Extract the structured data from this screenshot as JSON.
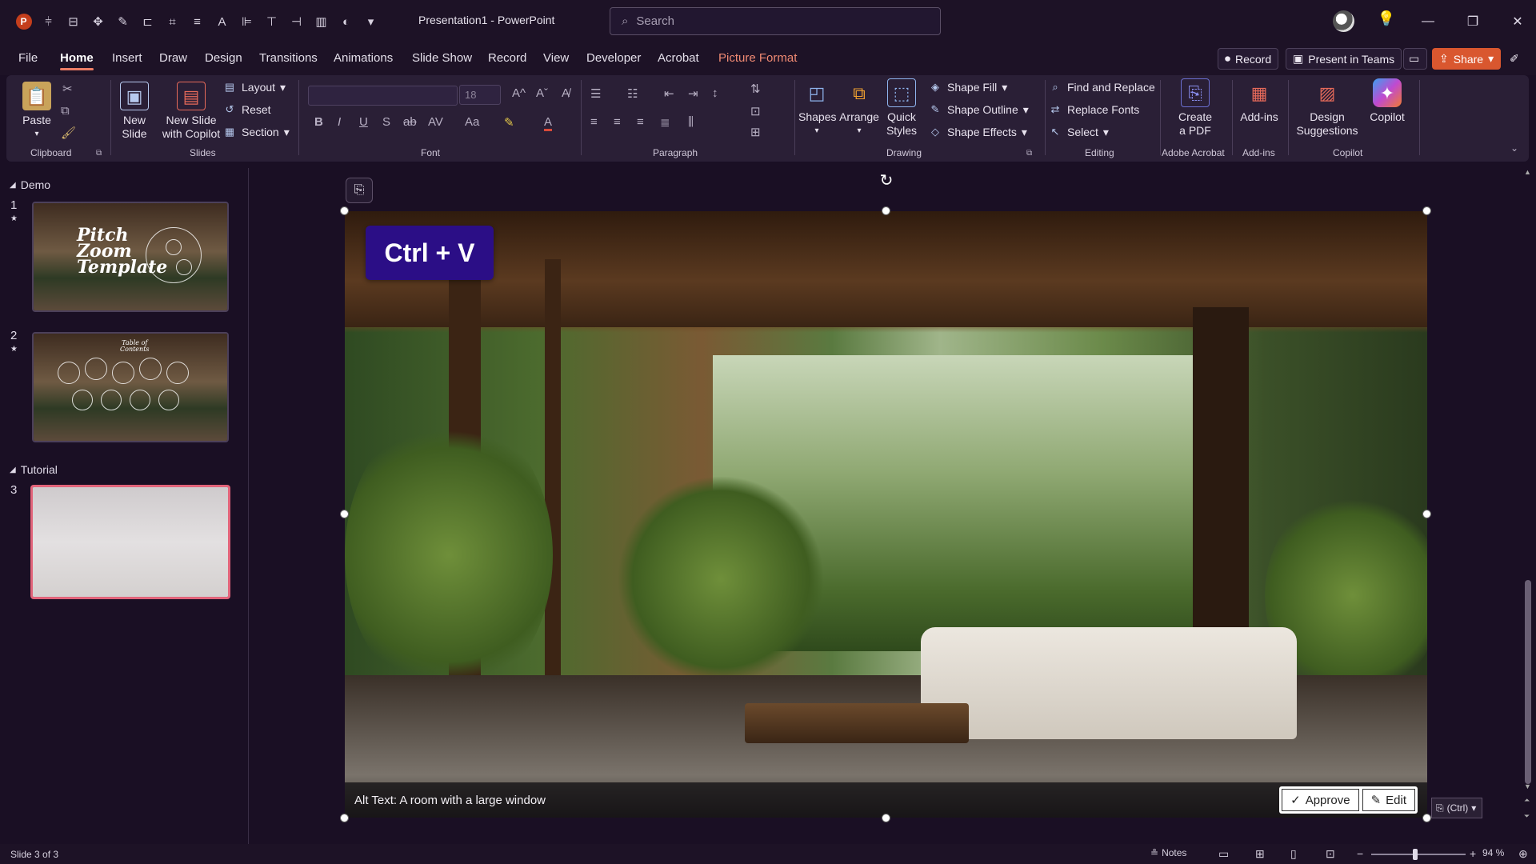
{
  "app": {
    "doc_title": "Presentation1  -  PowerPoint",
    "search_placeholder": "Search"
  },
  "menu": {
    "tabs": [
      "File",
      "Home",
      "Insert",
      "Draw",
      "Design",
      "Transitions",
      "Animations",
      "Slide Show",
      "Record",
      "View",
      "Developer",
      "Acrobat",
      "Picture Format"
    ],
    "active_tab": "Home",
    "record_label": "Record",
    "teams_label": "Present in Teams",
    "share_label": "Share"
  },
  "ribbon": {
    "clipboard": {
      "paste": "Paste",
      "group": "Clipboard"
    },
    "slides": {
      "new_slide": "New Slide",
      "new_slide_copilot_1": "New Slide",
      "new_slide_copilot_2": "with Copilot",
      "layout": "Layout",
      "reset": "Reset",
      "section": "Section",
      "group": "Slides"
    },
    "font": {
      "size": "18",
      "group": "Font"
    },
    "paragraph": {
      "group": "Paragraph"
    },
    "drawing": {
      "shapes": "Shapes",
      "arrange": "Arrange",
      "quick_styles_1": "Quick",
      "quick_styles_2": "Styles",
      "shape_fill": "Shape Fill",
      "shape_outline": "Shape Outline",
      "shape_effects": "Shape Effects",
      "group": "Drawing"
    },
    "editing": {
      "find_replace": "Find and Replace",
      "replace_fonts": "Replace Fonts",
      "select": "Select",
      "group": "Editing"
    },
    "acrobat": {
      "create_pdf_1": "Create",
      "create_pdf_2": "a PDF",
      "group": "Adobe Acrobat"
    },
    "addins": {
      "addins": "Add-ins",
      "group": "Add-ins"
    },
    "copilot": {
      "design_1": "Design",
      "design_2": "Suggestions",
      "copilot": "Copilot",
      "group": "Copilot"
    }
  },
  "slides_panel": {
    "sections": [
      {
        "name": "Demo"
      },
      {
        "name": "Tutorial"
      }
    ],
    "slides": [
      {
        "number": "1",
        "title_lines": [
          "Pitch",
          "Zoom",
          "Template"
        ]
      },
      {
        "number": "2",
        "title_lines": [
          "Table of",
          "Contents"
        ]
      },
      {
        "number": "3"
      }
    ]
  },
  "canvas": {
    "overlay_label": "Ctrl + V",
    "alt_text": "Alt Text: A room with a large window",
    "approve_label": "Approve",
    "edit_label": "Edit",
    "paste_options_label": "(Ctrl)"
  },
  "status": {
    "slide_counter": "Slide 3 of 3",
    "notes_label": "Notes",
    "zoom_level": "94 %",
    "zoom_fraction": 0.47
  },
  "colors": {
    "accent_tab_underline": "#ec7d66",
    "ctrlv_bg": "#2b0e86",
    "selected_slide_border": "#e2647a",
    "share_bg": "#d9572f"
  }
}
